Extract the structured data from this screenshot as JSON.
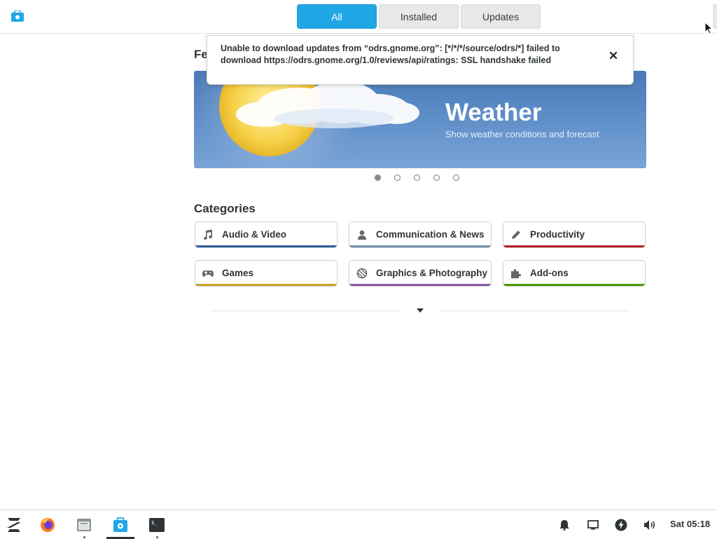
{
  "header": {
    "tabs": [
      {
        "label": "All",
        "active": true
      },
      {
        "label": "Installed",
        "active": false
      },
      {
        "label": "Updates",
        "active": false
      }
    ]
  },
  "featured": {
    "heading": "Fe",
    "banner_title": "Weather",
    "banner_subtitle": "Show weather conditions and forecast",
    "carousel_total": 5,
    "carousel_active": 1
  },
  "notification": {
    "message": "Unable to download updates from “odrs.gnome.org”: [*/*/*/source/odrs/*] failed to download https://odrs.gnome.org/1.0/reviews/api/ratings: SSL handshake failed",
    "close_icon": "close-icon"
  },
  "categories": {
    "heading": "Categories",
    "items": [
      {
        "label": "Audio & Video",
        "icon": "music-note-icon",
        "color": "#2a5f9e"
      },
      {
        "label": "Communication & News",
        "icon": "person-icon",
        "color": "#7593b2"
      },
      {
        "label": "Productivity",
        "icon": "pencil-icon",
        "color": "#c01c28"
      },
      {
        "label": "Games",
        "icon": "gamepad-icon",
        "color": "#c9a227"
      },
      {
        "label": "Graphics & Photography",
        "icon": "palette-icon",
        "color": "#8a5aa5"
      },
      {
        "label": "Add-ons",
        "icon": "puzzle-icon",
        "color": "#4e9a06"
      }
    ]
  },
  "taskbar": {
    "apps": [
      "zorin-menu-icon",
      "firefox-icon",
      "files-icon",
      "software-icon",
      "terminal-icon"
    ],
    "tray": [
      "bell-icon",
      "display-icon",
      "power-icon",
      "volume-icon"
    ],
    "clock": "Sat 05:18"
  },
  "colors": {
    "accent": "#1fa7e6",
    "banner": "#4a79b6"
  }
}
